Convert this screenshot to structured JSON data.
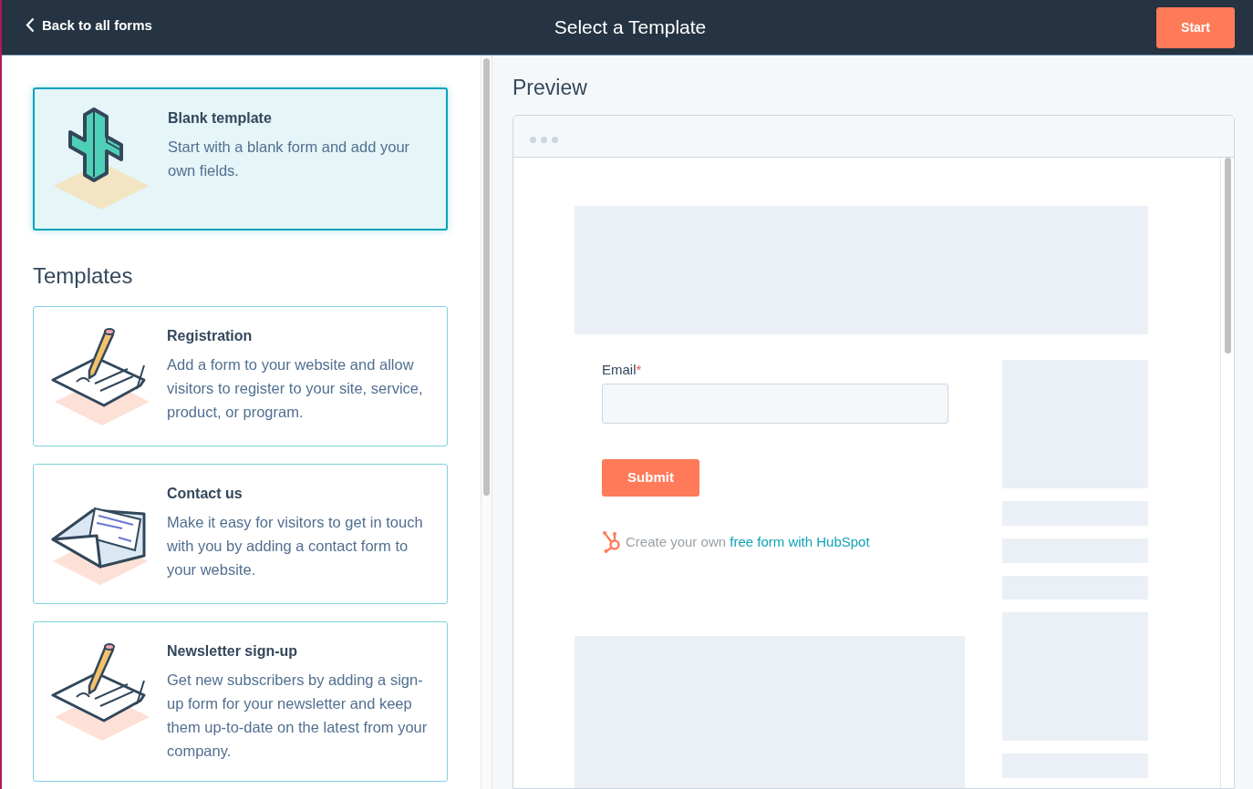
{
  "header": {
    "back_link": "Back to all forms",
    "title": "Select a Template",
    "start_button": "Start"
  },
  "blank_template": {
    "kind": "plus",
    "title": "Blank template",
    "description": "Start with a blank form and add your own fields.",
    "selected": true
  },
  "templates_heading": "Templates",
  "templates": [
    {
      "kind": "signing",
      "title": "Registration",
      "description": "Add a form to your website and allow visitors to register to your site, service, product, or program.",
      "selected": false
    },
    {
      "kind": "envelope",
      "title": "Contact us",
      "description": "Make it easy for visitors to get in touch with you by adding a contact form to your website.",
      "selected": false
    },
    {
      "kind": "signing",
      "title": "Newsletter sign-up",
      "description": "Get new subscribers by adding a sign-up form for your newsletter and keep them up-to-date on the latest from your company.",
      "selected": false
    }
  ],
  "preview": {
    "title": "Preview",
    "form": {
      "field_label": "Email",
      "required_mark": "*",
      "submit_button": "Submit",
      "footer_text": "Create your own ",
      "footer_link": "free form with HubSpot"
    }
  }
}
